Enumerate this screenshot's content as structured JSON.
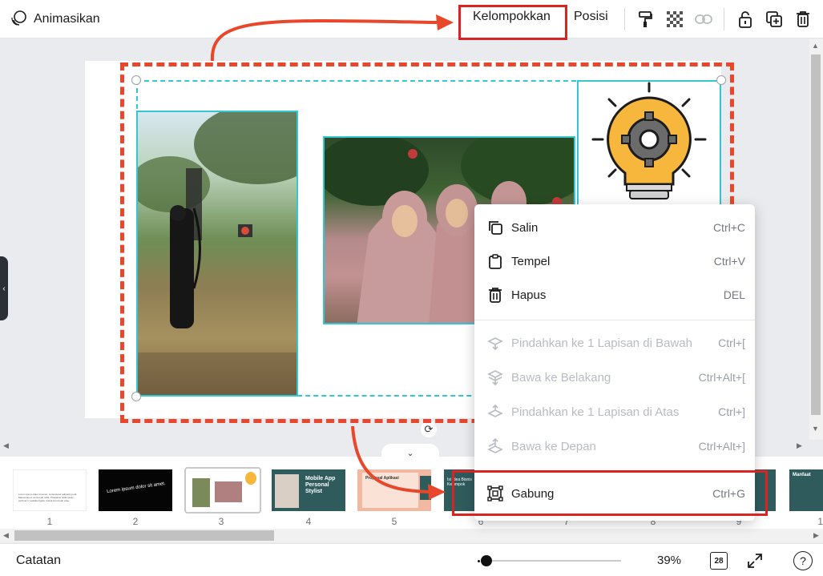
{
  "toolbar": {
    "animate_label": "Animasikan",
    "group_label": "Kelompokkan",
    "position_label": "Posisi",
    "icons": [
      "paint-roller-icon",
      "transparency-icon",
      "link-icon",
      "unlock-icon",
      "duplicate-icon",
      "trash-icon"
    ]
  },
  "context_menu": {
    "items": [
      {
        "label": "Salin",
        "shortcut": "Ctrl+C",
        "icon": "copy-icon",
        "disabled": false
      },
      {
        "label": "Tempel",
        "shortcut": "Ctrl+V",
        "icon": "paste-icon",
        "disabled": false
      },
      {
        "label": "Hapus",
        "shortcut": "DEL",
        "icon": "trash-icon",
        "disabled": false
      },
      {
        "label": "Pindahkan ke 1 Lapisan di Bawah",
        "shortcut": "Ctrl+[",
        "icon": "layer-down-icon",
        "disabled": true
      },
      {
        "label": "Bawa ke Belakang",
        "shortcut": "Ctrl+Alt+[",
        "icon": "send-back-icon",
        "disabled": true
      },
      {
        "label": "Pindahkan ke 1 Lapisan di Atas",
        "shortcut": "Ctrl+]",
        "icon": "layer-up-icon",
        "disabled": true
      },
      {
        "label": "Bawa ke Depan",
        "shortcut": "Ctrl+Alt+]",
        "icon": "bring-front-icon",
        "disabled": true
      },
      {
        "label": "Gabung",
        "shortcut": "Ctrl+G",
        "icon": "group-icon",
        "disabled": false
      }
    ]
  },
  "filmstrip": {
    "pages": [
      {
        "num": "1",
        "text": "Lorem ipsum dolor sit amet, consectetur adipiscing elit. Maecenas et commodo nulla. Phasellus nulla ipsum, pulvinar in sodales ligula, luctus commodo ante."
      },
      {
        "num": "2",
        "text": "Lorem ipsum dolor sit amet."
      },
      {
        "num": "3",
        "text": ""
      },
      {
        "num": "4",
        "text": "Mobile App Personal Stylist"
      },
      {
        "num": "5",
        "text": "Proposal Aplikasi"
      },
      {
        "num": "6",
        "text": "Isi Idea Bisnis Kelompok"
      },
      {
        "num": "7",
        "text": ""
      },
      {
        "num": "8",
        "text": ""
      },
      {
        "num": "9",
        "text": ""
      },
      {
        "num": "1",
        "text": "Manfaat"
      }
    ]
  },
  "bottombar": {
    "notes_label": "Catatan",
    "zoom": "39%",
    "page_count": "28",
    "help": "?"
  },
  "colors": {
    "selection_cyan": "#35c6d3",
    "annotation_red": "#e8472b",
    "highlight_red": "#d92424",
    "teal_slide": "#2f5b5d"
  }
}
